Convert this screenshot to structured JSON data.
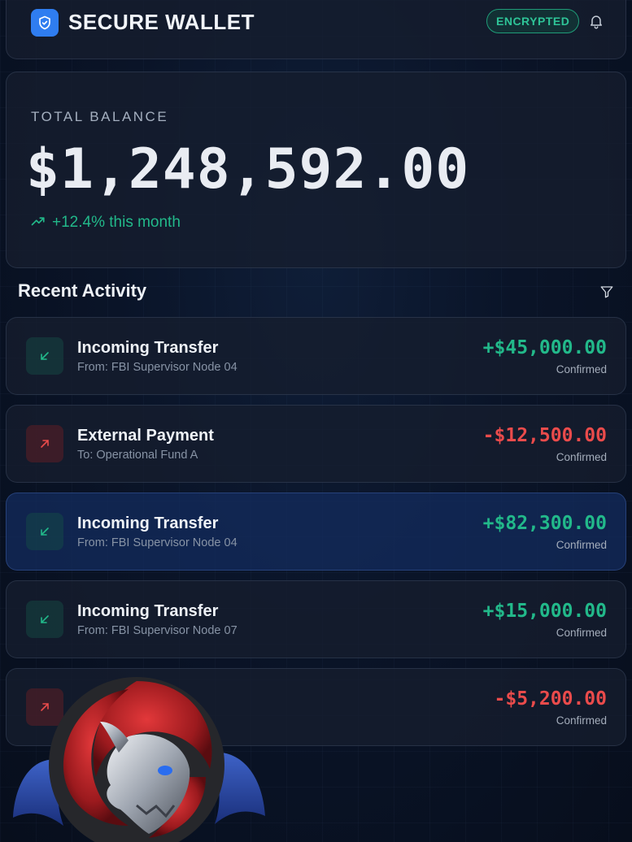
{
  "header": {
    "title": "SECURE WALLET",
    "badge": "ENCRYPTED",
    "brand_icon": "shield-icon",
    "bell_icon": "bell-icon"
  },
  "balance": {
    "label": "TOTAL BALANCE",
    "amount": "$1,248,592.00",
    "change": "+12.4% this month",
    "change_icon": "trending-up-icon"
  },
  "activity": {
    "title": "Recent Activity",
    "filter_icon": "filter-icon",
    "transactions": [
      {
        "type": "incoming",
        "title": "Incoming Transfer",
        "subtitle": "From: FBI Supervisor Node 04",
        "amount": "+$45,000.00",
        "status": "Confirmed"
      },
      {
        "type": "outgoing",
        "title": "External Payment",
        "subtitle": "To: Operational Fund A",
        "amount": "-$12,500.00",
        "status": "Confirmed"
      },
      {
        "type": "incoming",
        "title": "Incoming Transfer",
        "subtitle": "From: FBI Supervisor Node 04",
        "amount": "+$82,300.00",
        "status": "Confirmed"
      },
      {
        "type": "incoming",
        "title": "Incoming Transfer",
        "subtitle": "From: FBI Supervisor Node 07",
        "amount": "+$15,000.00",
        "status": "Confirmed"
      },
      {
        "type": "outgoing",
        "title": "",
        "subtitle": "",
        "amount": "-$5,200.00",
        "status": "Confirmed"
      }
    ]
  },
  "colors": {
    "accent_blue": "#2f7df0",
    "positive": "#22b98a",
    "negative": "#ea4b4b",
    "background": "#0a1428"
  }
}
